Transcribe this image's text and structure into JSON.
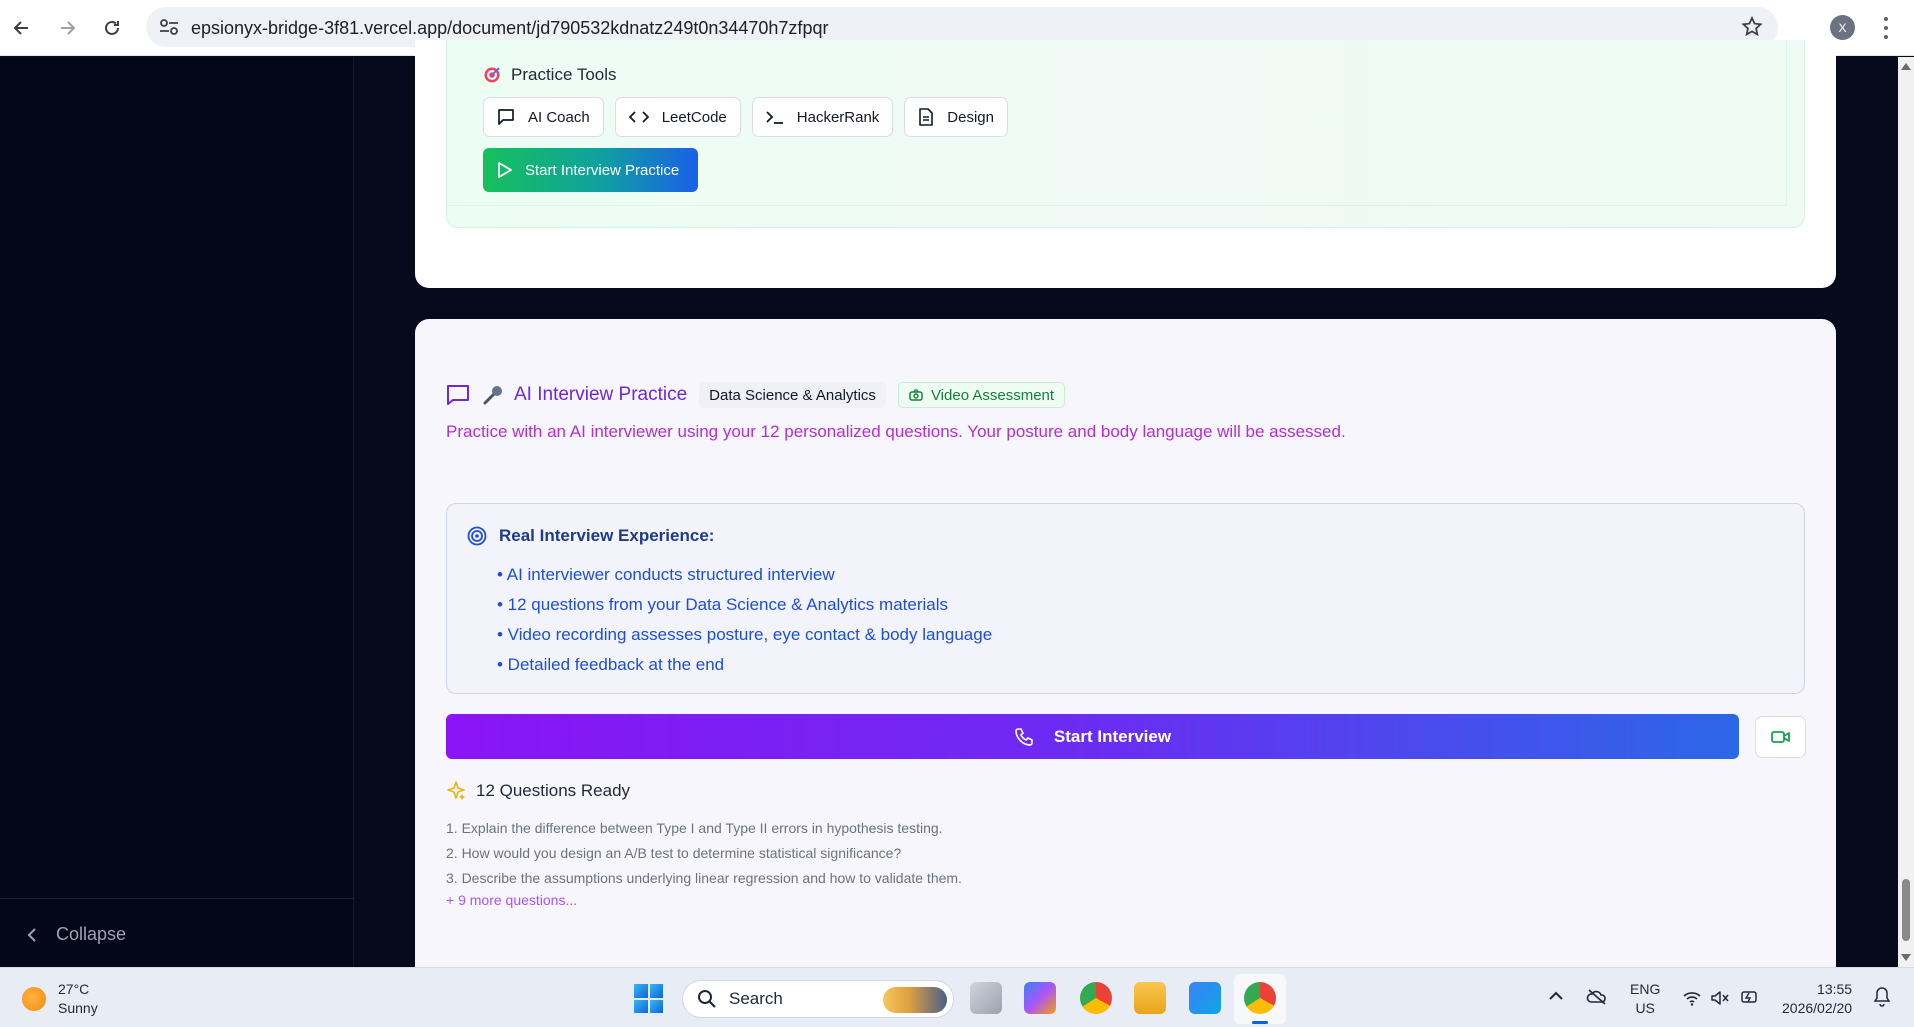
{
  "browser": {
    "url": "epsionyx-bridge-3f81.vercel.app/document/jd790532kdnatz249t0n34470h7zfpqr",
    "profile_initial": "X"
  },
  "sidebar": {
    "collapse_label": "Collapse"
  },
  "practice_tools": {
    "title": "Practice Tools",
    "tools": [
      {
        "label": "AI Coach",
        "icon": "chat-bubble-icon"
      },
      {
        "label": "LeetCode",
        "icon": "code-icon"
      },
      {
        "label": "HackerRank",
        "icon": "terminal-icon"
      },
      {
        "label": "Design",
        "icon": "document-icon"
      }
    ],
    "start_label": "Start Interview Practice"
  },
  "ai_practice": {
    "title": "AI Interview Practice",
    "domain_chip": "Data Science & Analytics",
    "video_chip": "Video Assessment",
    "subtitle": "Practice with an AI interviewer using your 12 personalized questions. Your posture and body language will be assessed.",
    "experience_title": "Real Interview Experience:",
    "experience_items": [
      "• AI interviewer conducts structured interview",
      "• 12 questions from your Data Science & Analytics materials",
      "• Video recording assesses posture, eye contact & body language",
      "• Detailed feedback at the end"
    ],
    "start_label": "Start Interview",
    "questions_title": "12 Questions Ready",
    "questions": [
      "1. Explain the difference between Type I and Type II errors in hypothesis testing.",
      "2. How would you design an A/B test to determine statistical significance?",
      "3. Describe the assumptions underlying linear regression and how to validate them."
    ],
    "more_label": "+ 9 more questions..."
  },
  "taskbar": {
    "temperature": "27°C",
    "condition": "Sunny",
    "search_placeholder": "Search",
    "lang_top": "ENG",
    "lang_bottom": "US",
    "time": "13:55",
    "date": "2026/02/20"
  },
  "colors": {
    "accent_purple": "#6d28d9",
    "accent_green": "#16c05c",
    "accent_blue": "#1d4ed8"
  }
}
